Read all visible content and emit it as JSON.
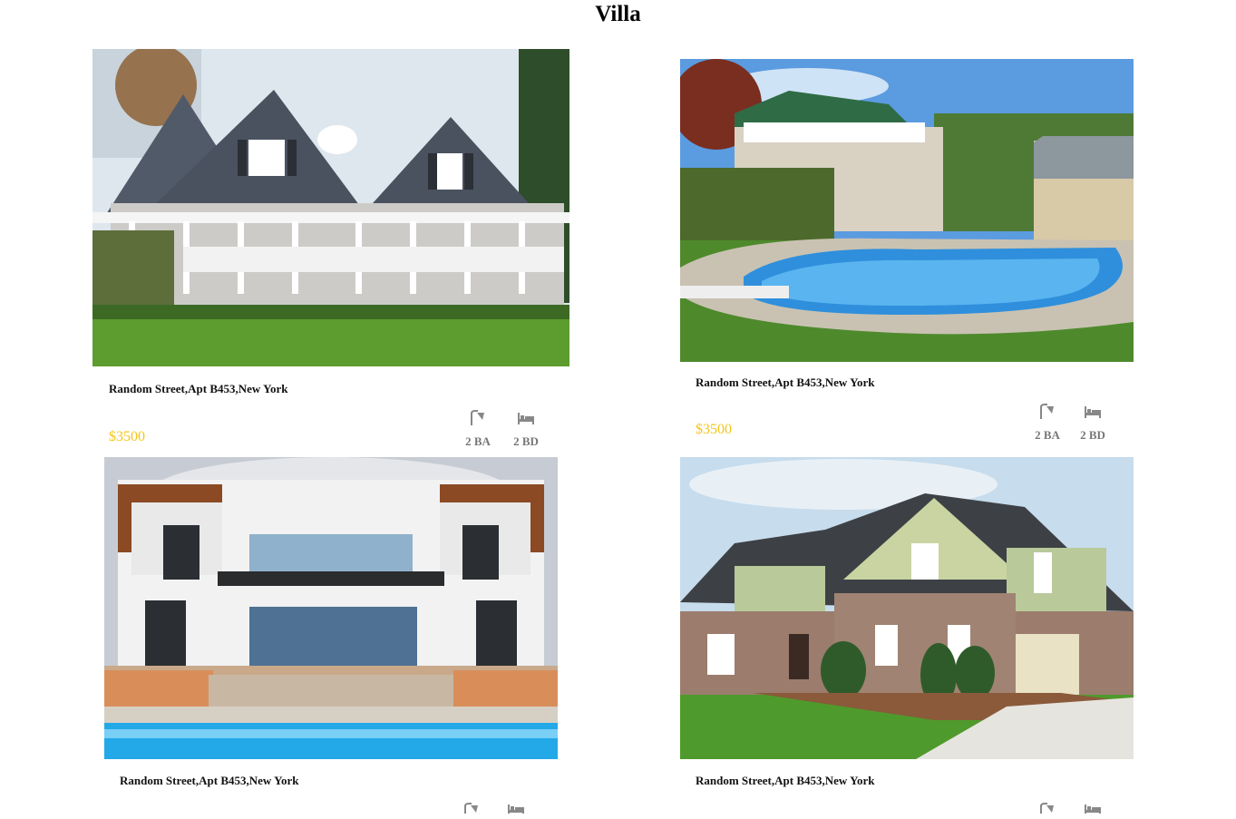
{
  "page": {
    "title": "Villa"
  },
  "listings": [
    {
      "address": "Random Street,Apt B453,New York",
      "price": "$3500",
      "baths": "2 BA",
      "beds": "2 BD",
      "image": "grey-shingle-house-with-porch"
    },
    {
      "address": "Random Street,Apt B453,New York",
      "price": "$3500",
      "baths": "2 BA",
      "beds": "2 BD",
      "image": "house-with-swimming-pool"
    },
    {
      "address": "Random Street,Apt B453,New York",
      "image": "modern-white-villa-with-pool"
    },
    {
      "address": "Random Street,Apt B453,New York",
      "image": "brick-suburban-house"
    }
  ],
  "icons": {
    "bath": "shower-icon",
    "bed": "bed-icon"
  },
  "colors": {
    "price": "#f5c518",
    "feature_label": "#777777",
    "icon": "#888888"
  }
}
